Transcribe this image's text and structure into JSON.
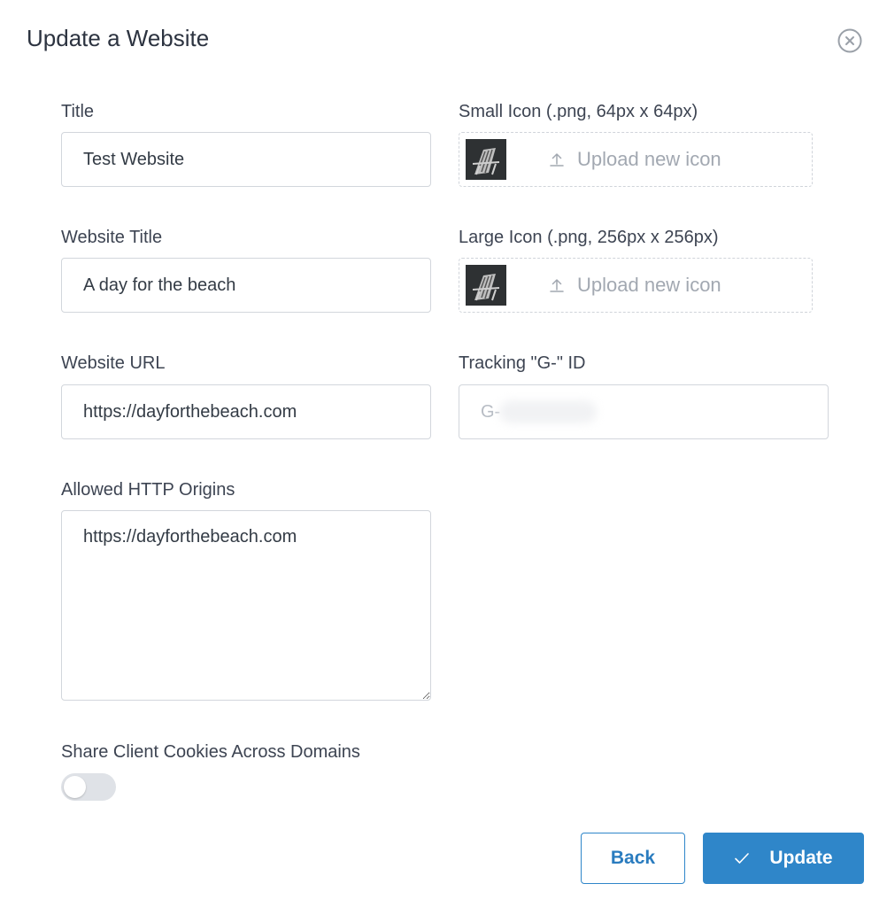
{
  "dialog": {
    "title": "Update a Website",
    "close_icon": "close-circle-icon"
  },
  "fields": {
    "title": {
      "label": "Title",
      "value": "Test Website"
    },
    "website_title": {
      "label": "Website Title",
      "value": "A day for the beach"
    },
    "website_url": {
      "label": "Website URL",
      "value": "https://dayforthebeach.com"
    },
    "allowed_origins": {
      "label": "Allowed HTTP Origins",
      "value": "https://dayforthebeach.com"
    },
    "small_icon": {
      "label": "Small Icon (.png, 64px x 64px)",
      "upload_text": "Upload new icon",
      "icon": "upload-icon"
    },
    "large_icon": {
      "label": "Large Icon (.png, 256px x 256px)",
      "upload_text": "Upload new icon",
      "icon": "upload-icon"
    },
    "tracking_id": {
      "label": "Tracking \"G-\" ID",
      "value": "G-"
    }
  },
  "share_cookies": {
    "label": "Share Client Cookies Across Domains",
    "enabled": false
  },
  "buttons": {
    "back": "Back",
    "update": "Update",
    "update_icon": "checkmark-icon"
  },
  "colors": {
    "primary": "#2f86c9",
    "border": "#d2d6dc",
    "toggle_off": "#dfe2e7"
  }
}
